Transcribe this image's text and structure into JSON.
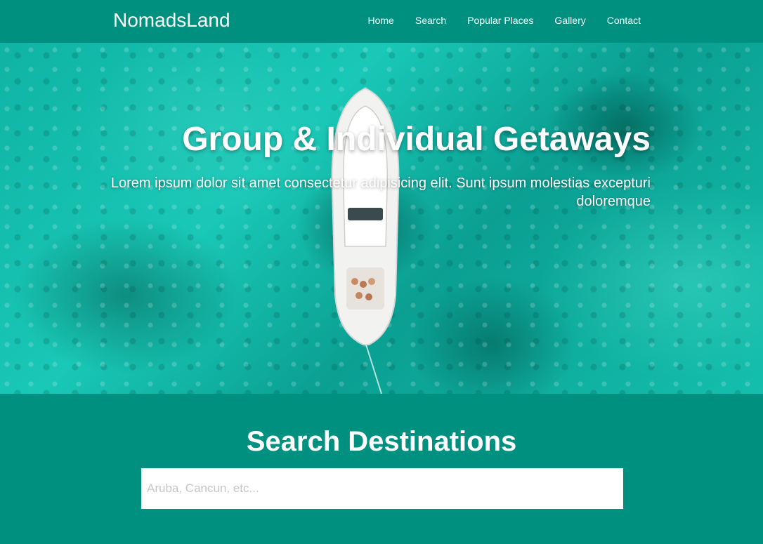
{
  "nav": {
    "brand": "NomadsLand",
    "links": [
      {
        "label": "Home"
      },
      {
        "label": "Search"
      },
      {
        "label": "Popular Places"
      },
      {
        "label": "Gallery"
      },
      {
        "label": "Contact"
      }
    ]
  },
  "hero": {
    "title": "Group & Individual Getaways",
    "subtitle": "Lorem ipsum dolor sit amet consectetur adipisicing elit. Sunt ipsum molestias excepturi doloremque"
  },
  "search": {
    "title": "Search Destinations",
    "placeholder": "Aruba, Cancun, etc..."
  },
  "colors": {
    "primary": "#009080",
    "text": "#ffffff"
  }
}
